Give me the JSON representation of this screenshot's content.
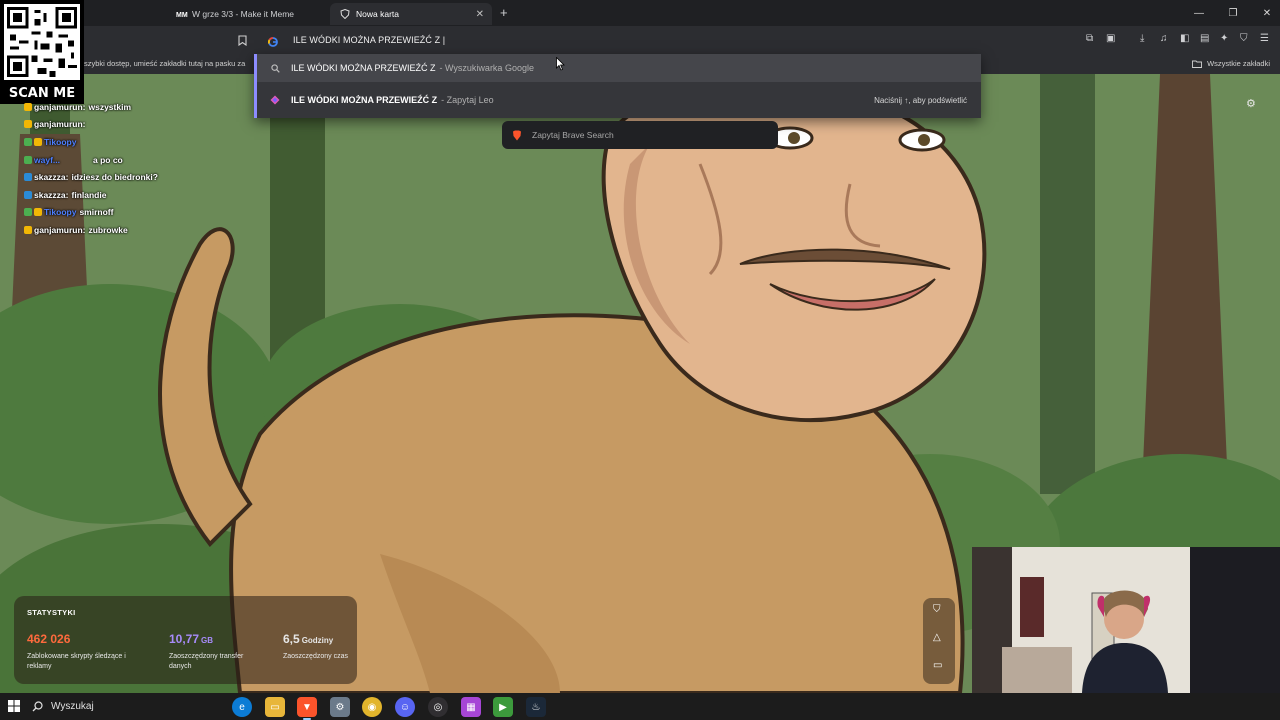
{
  "tabs": [
    {
      "title": "W grze 3/3 - Make it Meme",
      "active": false,
      "favicon": "make-it-meme-icon"
    },
    {
      "title": "Nowa karta",
      "active": true,
      "favicon": "brave-shield-icon"
    }
  ],
  "address_bar": {
    "value": "ILE WÓDKI MOŻNA PRZEWIEŹĆ Z |",
    "search_engine_icon": "google-icon"
  },
  "bookmarks_bar": {
    "hint": "szybki dostęp, umieść zakładki tutaj na pasku za",
    "all_bookmarks": "Wszystkie zakładki"
  },
  "suggestions": [
    {
      "query": "ILE WÓDKI MOŻNA PRZEWIEŹĆ Z",
      "suffix": "- Wyszukiwarka Google",
      "icon": "search-icon",
      "bold": false
    },
    {
      "query": "ILE WÓDKI MOŻNA PRZEWIEŹĆ Z",
      "suffix": "- Zapytaj Leo",
      "icon": "leo-icon",
      "bold": true,
      "hint": "Naciśnij ↑, aby podświetlić"
    }
  ],
  "brave_ask": "Zapytaj Brave Search",
  "qr": {
    "label": "SCAN ME"
  },
  "chat": [
    {
      "user": "ganjamurun:",
      "message": "wszystkim",
      "user_color": "#ffffff"
    },
    {
      "user": "ganjamurun:",
      "message": "",
      "user_color": "#ffffff"
    },
    {
      "user": "Tikoopy",
      "message": "",
      "user_color": "#4d7fff"
    },
    {
      "user": "wayf...",
      "message": "a po co",
      "user_color": "#4d7fff"
    },
    {
      "user": "skazzza:",
      "message": "idziesz do biedronki?",
      "user_color": "#ffffff"
    },
    {
      "user": "skazzza:",
      "message": "finlandie",
      "user_color": "#ffffff"
    },
    {
      "user": "Tikoopy",
      "message": "smirnoff",
      "user_color": "#4d7fff"
    },
    {
      "user": "ganjamurun:",
      "message": "zubrowke",
      "user_color": "#ffffff"
    }
  ],
  "stats": {
    "title": "STATYSTYKI",
    "items": [
      {
        "value": "462 026",
        "unit": "",
        "desc": "Zablokowane skrypty śledzące i reklamy",
        "color": "#ff6a3d"
      },
      {
        "value": "10,77",
        "unit": "GB",
        "desc": "Zaoszczędzony transfer danych",
        "color": "#a78bfa"
      },
      {
        "value": "6,5",
        "unit": "Godziny",
        "desc": "Zaoszczędzony czas",
        "color": "#ffffff"
      }
    ]
  },
  "taskbar": {
    "search_label": "Wyszukaj",
    "apps": [
      "edge-icon",
      "file-explorer-icon",
      "brave-icon",
      "tool-icon",
      "chrome-icon",
      "discord-icon",
      "obs-icon",
      "app-icon",
      "play-icon",
      "steam-icon"
    ]
  },
  "colors": {
    "accent": "#8c8cff",
    "toolbar_bg": "#2c2d31",
    "dropdown_bg": "#35363a"
  }
}
